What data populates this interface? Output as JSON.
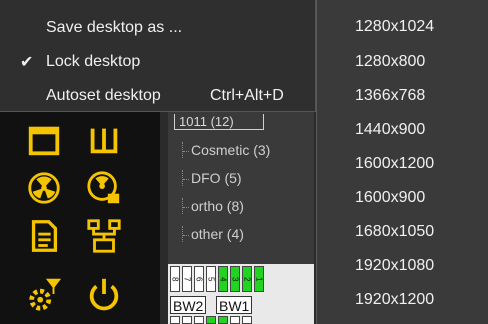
{
  "menu": {
    "items": [
      {
        "label": "Save desktop as ...",
        "checked": false,
        "shortcut": ""
      },
      {
        "label": "Lock desktop",
        "checked": true,
        "shortcut": ""
      },
      {
        "label": "Autoset desktop",
        "checked": false,
        "shortcut": "Ctrl+Alt+D"
      }
    ],
    "check_glyph": "✔"
  },
  "resolutions": [
    "1280x1024",
    "1280x800",
    "1366x768",
    "1440x900",
    "1600x1200",
    "1600x900",
    "1680x1050",
    "1920x1080",
    "1920x1200"
  ],
  "tree": {
    "top_partial": "1011 (12)",
    "items": [
      "Cosmetic (3)",
      "DFO (5)",
      "ortho (8)",
      "other (4)"
    ]
  },
  "strip": {
    "cells": [
      {
        "text": "8",
        "green": false
      },
      {
        "text": "7",
        "green": false
      },
      {
        "text": "6",
        "green": false
      },
      {
        "text": "5",
        "green": false
      },
      {
        "text": "4",
        "green": true
      },
      {
        "text": "3",
        "green": true
      },
      {
        "text": "2",
        "green": true
      },
      {
        "text": "1",
        "green": true
      }
    ],
    "bw_labels": [
      "BW2",
      "BW1"
    ]
  },
  "colors": {
    "icon_yellow": "#f5c400",
    "accent_green": "#22d322",
    "menu_bg": "#2f2f2f",
    "list_bg": "#3a3a3a"
  },
  "icons": [
    "calendar-icon",
    "tooth-grid-icon",
    "radiation-icon",
    "radiation-settings-icon",
    "document-icon",
    "network-icon",
    "settings-funnel-icon",
    "power-icon"
  ]
}
